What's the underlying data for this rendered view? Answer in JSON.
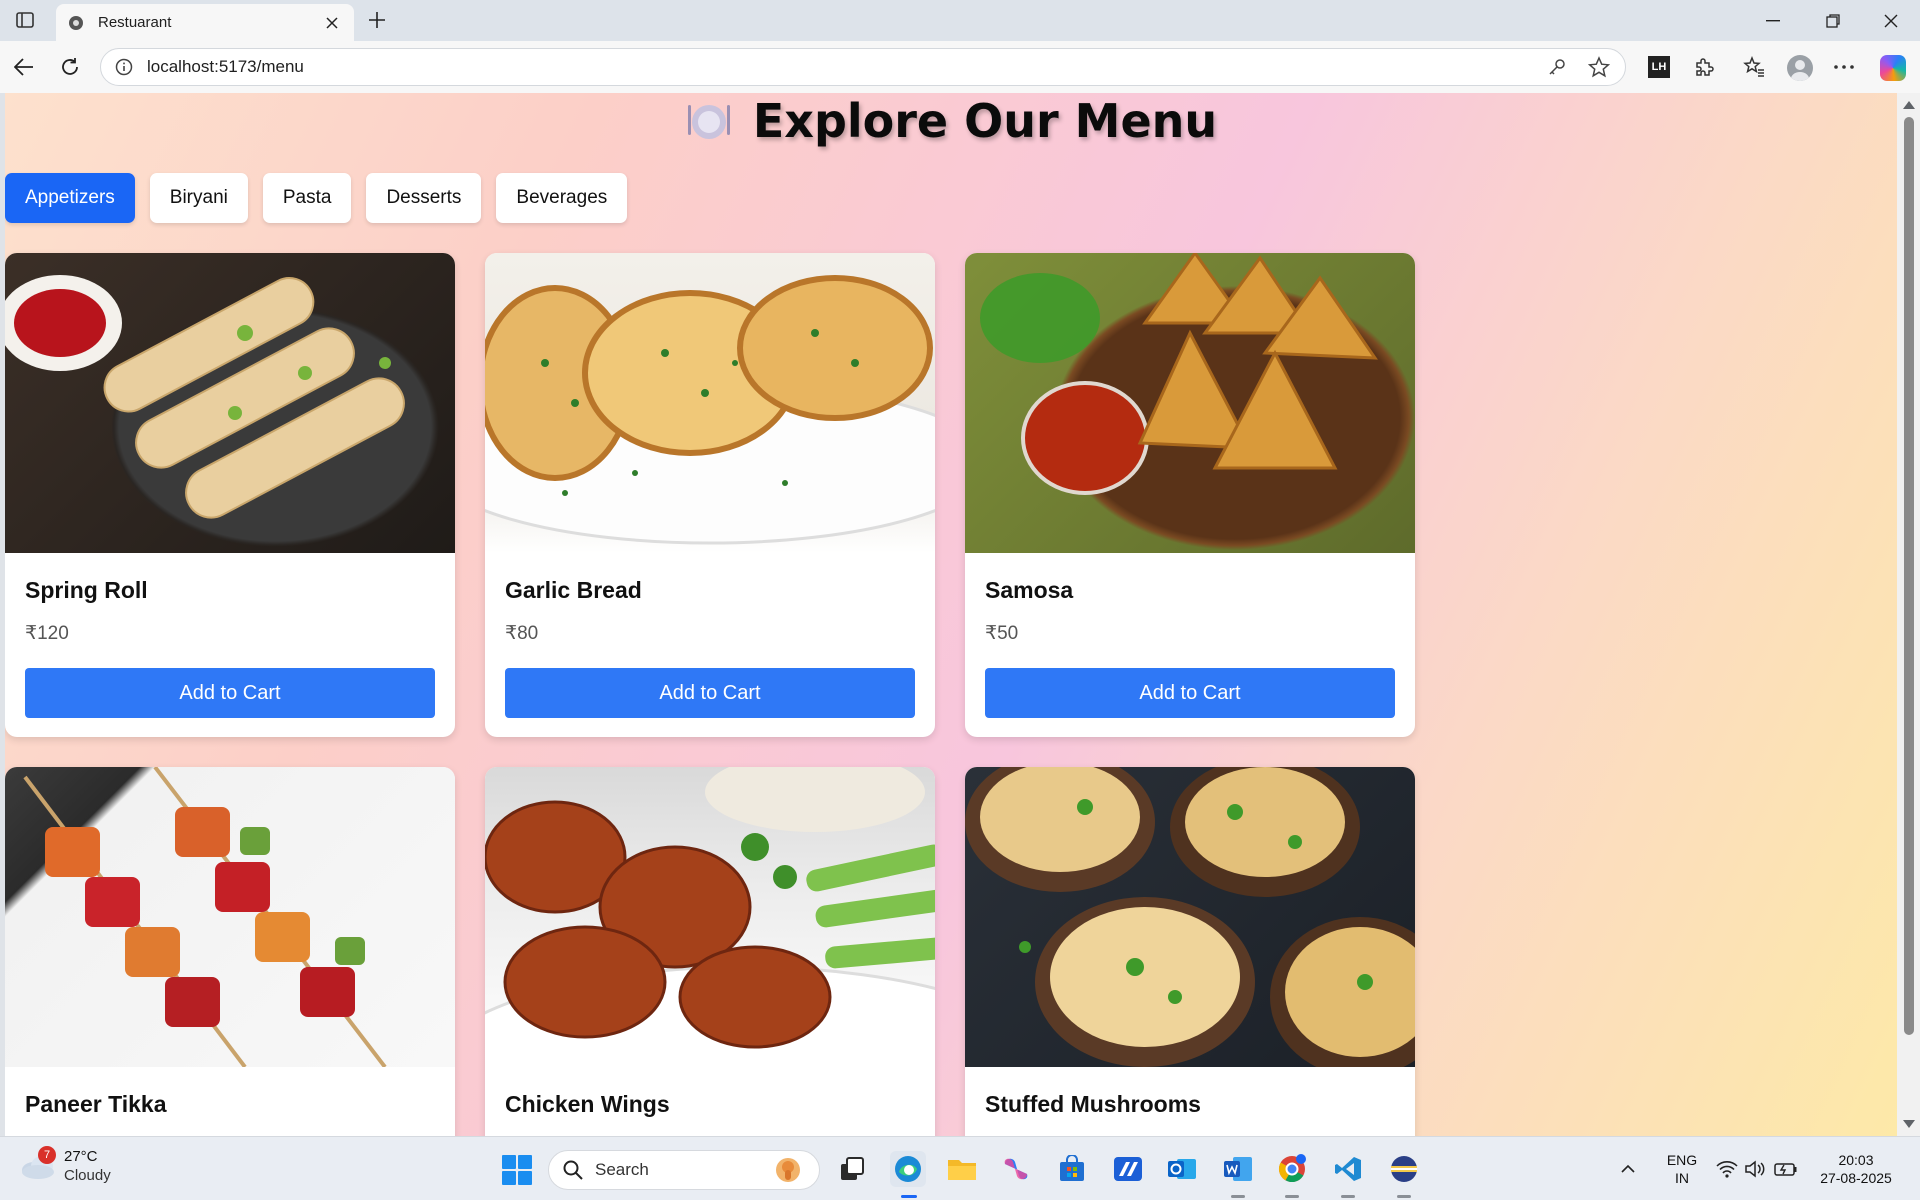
{
  "browser": {
    "tab_title": "Restuarant",
    "url": "localhost:5173/menu"
  },
  "page": {
    "title": "Explore Our Menu",
    "categories": [
      {
        "label": "Appetizers",
        "active": true
      },
      {
        "label": "Biryani",
        "active": false
      },
      {
        "label": "Pasta",
        "active": false
      },
      {
        "label": "Desserts",
        "active": false
      },
      {
        "label": "Beverages",
        "active": false
      }
    ],
    "items": [
      {
        "name": "Spring Roll",
        "price": "₹120",
        "button": "Add to Cart",
        "photo": "spring-roll-photo"
      },
      {
        "name": "Garlic Bread",
        "price": "₹80",
        "button": "Add to Cart",
        "photo": "garlic-bread-photo"
      },
      {
        "name": "Samosa",
        "price": "₹50",
        "button": "Add to Cart",
        "photo": "samosa-photo"
      },
      {
        "name": "Paneer Tikka",
        "price": "",
        "button": "",
        "photo": "paneer-tikka-photo"
      },
      {
        "name": "Chicken Wings",
        "price": "",
        "button": "",
        "photo": "chicken-wings-photo"
      },
      {
        "name": "Stuffed Mushrooms",
        "price": "",
        "button": "",
        "photo": "stuffed-mushrooms-photo"
      }
    ]
  },
  "taskbar": {
    "weather_badge": "7",
    "temperature": "27°C",
    "condition": "Cloudy",
    "search_label": "Search",
    "lang_top": "ENG",
    "lang_bottom": "IN",
    "time": "20:03",
    "date": "27-08-2025"
  },
  "colors": {
    "accent": "#1a66f5",
    "button": "#2f78f6"
  }
}
